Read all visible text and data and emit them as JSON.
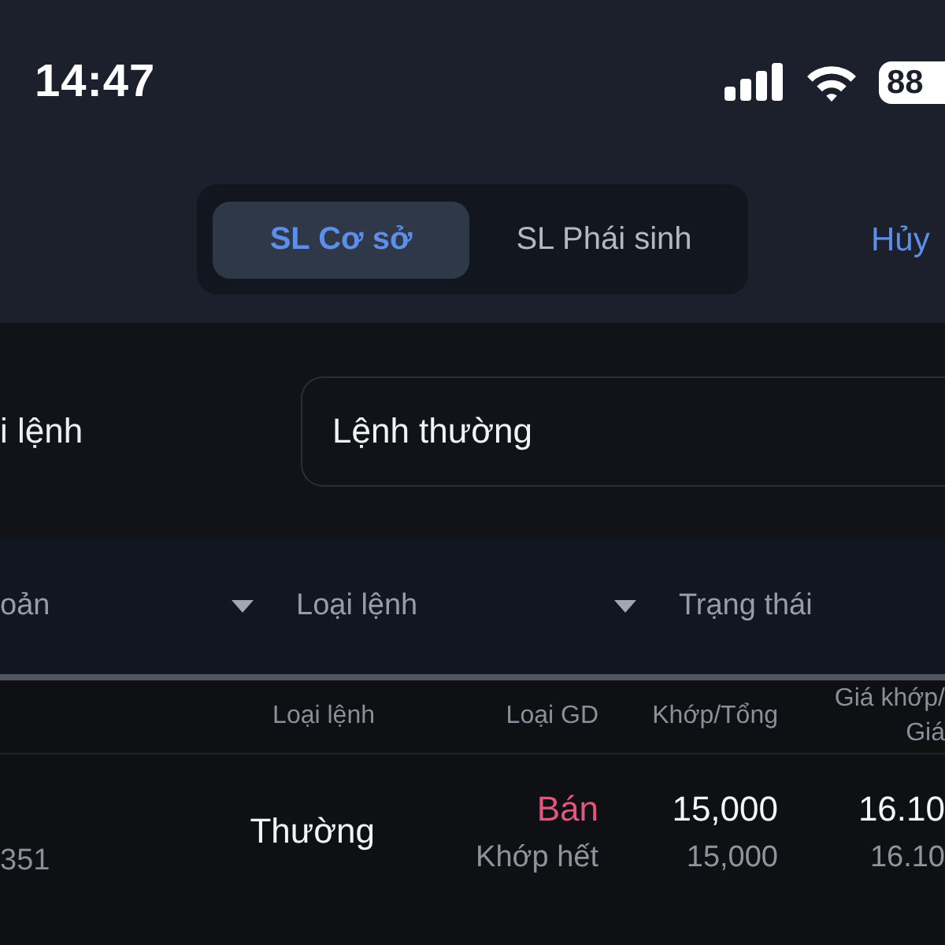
{
  "status_bar": {
    "time": "14:47",
    "battery": "88"
  },
  "header": {
    "tabs": [
      {
        "label": "SL Cơ sở",
        "selected": true
      },
      {
        "label": "SL Phái sinh",
        "selected": false
      }
    ],
    "cancel": "Hủy"
  },
  "order_type_field": {
    "label": "i lệnh",
    "value": "Lệnh thường"
  },
  "filters": [
    {
      "label": "oản",
      "caret": true
    },
    {
      "label": "Loại lệnh",
      "caret": true
    },
    {
      "label": "Trạng thái",
      "caret": false
    }
  ],
  "table": {
    "columns": [
      {
        "label": "Loại lệnh"
      },
      {
        "label": "Loại GD"
      },
      {
        "label": "Khớp/Tổng"
      },
      {
        "label": "Giá khớp/",
        "label_2": "Giá"
      }
    ],
    "rows": [
      {
        "account": "351",
        "order_type": "Thường",
        "side": {
          "text": "Bán",
          "color": "#e2577b"
        },
        "status": "Khớp hết",
        "matched": "15,000",
        "total": "15,000",
        "price": "16.10",
        "price_2": "16.10"
      }
    ]
  }
}
